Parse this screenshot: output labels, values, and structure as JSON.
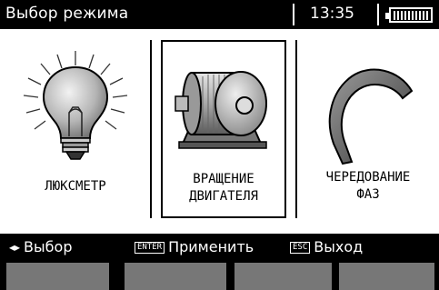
{
  "header": {
    "title": "Выбор режима",
    "time": "13:35",
    "battery_level": 1.0
  },
  "modes": [
    {
      "label_line1": "ЛЮКСМЕТР",
      "label_line2": "",
      "icon": "light-bulb-icon",
      "selected": false
    },
    {
      "label_line1": "ВРАЩЕНИЕ",
      "label_line2": "ДВИГАТЕЛЯ",
      "icon": "motor-icon",
      "selected": true
    },
    {
      "label_line1": "ЧЕРЕДОВАНИЕ",
      "label_line2": "ФАЗ",
      "icon": "phase-arc-icon",
      "selected": false
    }
  ],
  "hints": {
    "select_arrows": "◂▸",
    "select_label": "Выбор",
    "enter_key": "ENTER",
    "enter_label": "Применить",
    "esc_key": "ESC",
    "esc_label": "Выход"
  },
  "colors": {
    "background": "#000000",
    "panel": "#ffffff",
    "softkey": "#777777"
  }
}
